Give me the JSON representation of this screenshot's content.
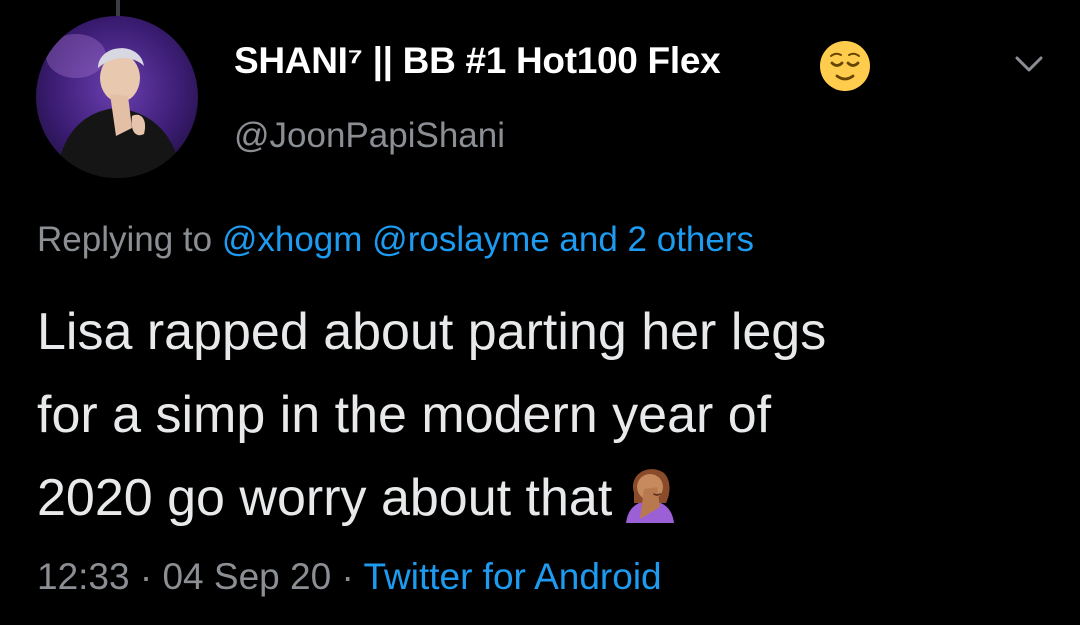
{
  "tweet": {
    "display_name": "SHANI⁷ || BB #1 Hot100 Flex",
    "handle": "@JoonPapiShani",
    "reply_prefix": "Replying to",
    "reply_user_1": "@xhogm",
    "reply_user_2": "@roslayme",
    "reply_others": "and 2 others",
    "text_lines": [
      "Lisa rapped about parting her legs",
      "for a simp in the modern year of",
      "2020 go worry about that"
    ],
    "time": "12:33",
    "date": "04 Sep 20",
    "separator": "·",
    "source": "Twitter for Android"
  },
  "icons": {
    "name_emoji": "relieved-face-emoji",
    "text_emoji": "person-facepalming-emoji",
    "more_menu": "chevron-down-icon"
  },
  "colors": {
    "background": "#000000",
    "name": "#ffffff",
    "text": "#e7e9ea",
    "secondary": "#8b8f94",
    "link": "#1d9bf0"
  }
}
